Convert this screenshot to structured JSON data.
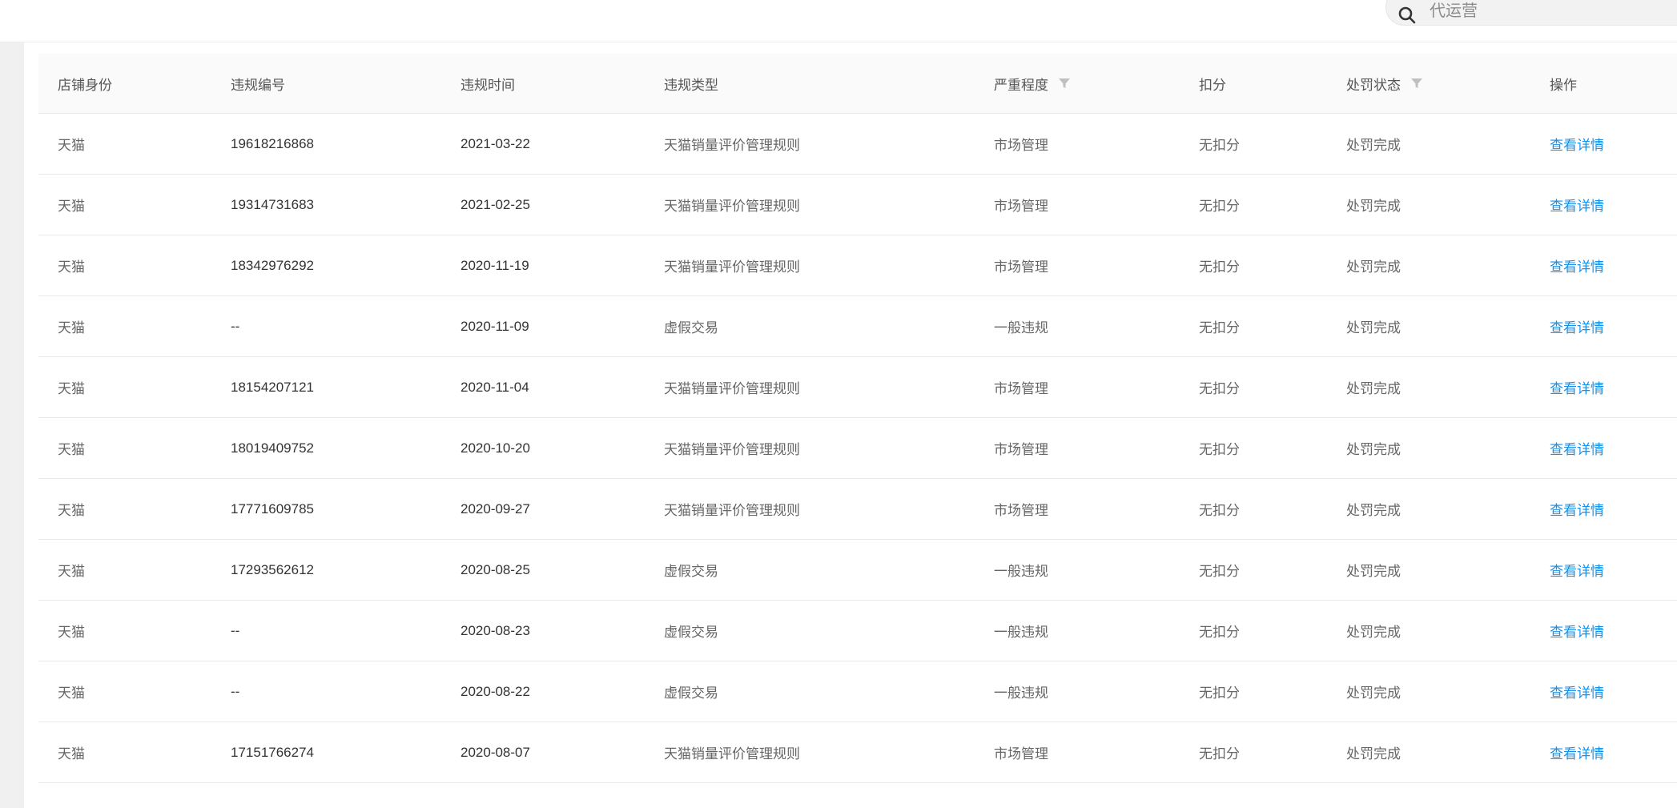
{
  "search": {
    "placeholder": "代运营",
    "icon": "search-icon"
  },
  "table": {
    "headers": {
      "shop_identity": "店铺身份",
      "violation_no": "违规编号",
      "violation_time": "违规时间",
      "violation_type": "违规类型",
      "severity": "严重程度",
      "deduction": "扣分",
      "penalty_status": "处罚状态",
      "action": "操作"
    },
    "rows": [
      {
        "shop": "天猫",
        "no": "19618216868",
        "time": "2021-03-22",
        "type": "天猫销量评价管理规则",
        "severity": "市场管理",
        "deduction": "无扣分",
        "status": "处罚完成",
        "action": "查看详情"
      },
      {
        "shop": "天猫",
        "no": "19314731683",
        "time": "2021-02-25",
        "type": "天猫销量评价管理规则",
        "severity": "市场管理",
        "deduction": "无扣分",
        "status": "处罚完成",
        "action": "查看详情"
      },
      {
        "shop": "天猫",
        "no": "18342976292",
        "time": "2020-11-19",
        "type": "天猫销量评价管理规则",
        "severity": "市场管理",
        "deduction": "无扣分",
        "status": "处罚完成",
        "action": "查看详情"
      },
      {
        "shop": "天猫",
        "no": "--",
        "time": "2020-11-09",
        "type": "虚假交易",
        "severity": "一般违规",
        "deduction": "无扣分",
        "status": "处罚完成",
        "action": "查看详情"
      },
      {
        "shop": "天猫",
        "no": "18154207121",
        "time": "2020-11-04",
        "type": "天猫销量评价管理规则",
        "severity": "市场管理",
        "deduction": "无扣分",
        "status": "处罚完成",
        "action": "查看详情"
      },
      {
        "shop": "天猫",
        "no": "18019409752",
        "time": "2020-10-20",
        "type": "天猫销量评价管理规则",
        "severity": "市场管理",
        "deduction": "无扣分",
        "status": "处罚完成",
        "action": "查看详情"
      },
      {
        "shop": "天猫",
        "no": "17771609785",
        "time": "2020-09-27",
        "type": "天猫销量评价管理规则",
        "severity": "市场管理",
        "deduction": "无扣分",
        "status": "处罚完成",
        "action": "查看详情"
      },
      {
        "shop": "天猫",
        "no": "17293562612",
        "time": "2020-08-25",
        "type": "虚假交易",
        "severity": "一般违规",
        "deduction": "无扣分",
        "status": "处罚完成",
        "action": "查看详情"
      },
      {
        "shop": "天猫",
        "no": "--",
        "time": "2020-08-23",
        "type": "虚假交易",
        "severity": "一般违规",
        "deduction": "无扣分",
        "status": "处罚完成",
        "action": "查看详情"
      },
      {
        "shop": "天猫",
        "no": "--",
        "time": "2020-08-22",
        "type": "虚假交易",
        "severity": "一般违规",
        "deduction": "无扣分",
        "status": "处罚完成",
        "action": "查看详情"
      },
      {
        "shop": "天猫",
        "no": "17151766274",
        "time": "2020-08-07",
        "type": "天猫销量评价管理规则",
        "severity": "市场管理",
        "deduction": "无扣分",
        "status": "处罚完成",
        "action": "查看详情"
      }
    ]
  },
  "colors": {
    "link": "#1a90e6",
    "header_bg": "#fafafa",
    "border": "#e8e8e8",
    "page_bg": "#f0f0f0"
  }
}
